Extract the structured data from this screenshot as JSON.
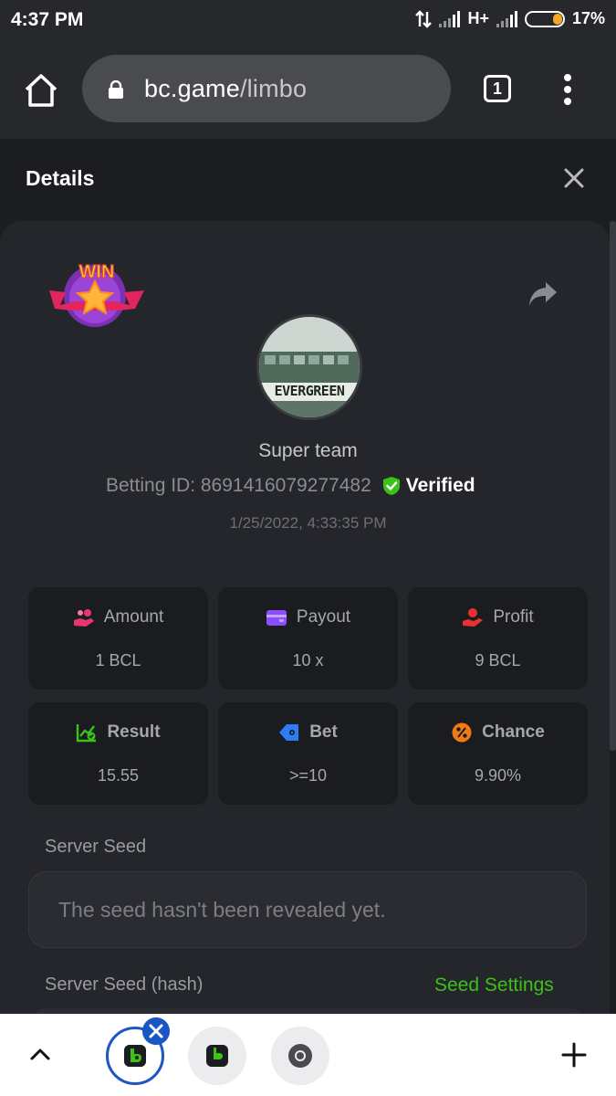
{
  "status_bar": {
    "time": "4:37 PM",
    "network": "H+",
    "battery": "17%"
  },
  "browser": {
    "url_domain": "bc.game",
    "url_path": "/limbo",
    "tab_count": "1"
  },
  "details": {
    "title": "Details",
    "username": "Super team",
    "betting_id_label": "Betting ID: 8691416079277482",
    "verified_label": "Verified",
    "timestamp": "1/25/2022, 4:33:35 PM",
    "avatar_text": "EVERGREEN",
    "win_badge_text": "WIN"
  },
  "stats": [
    {
      "label": "Amount",
      "value": "1 BCL",
      "icon": "coins-hand-icon",
      "color": "#e8376c"
    },
    {
      "label": "Payout",
      "value": "10 x",
      "icon": "wallet-icon",
      "color": "#8a4dff"
    },
    {
      "label": "Profit",
      "value": "9 BCL",
      "icon": "hand-coin-icon",
      "color": "#e8322f"
    },
    {
      "label": "Result",
      "value": "15.55",
      "icon": "chart-check-icon",
      "color": "#3bc117"
    },
    {
      "label": "Bet",
      "value": ">=10",
      "icon": "tag-icon",
      "color": "#2c7cf6"
    },
    {
      "label": "Chance",
      "value": "9.90%",
      "icon": "percent-icon",
      "color": "#f07b16"
    }
  ],
  "server_seed": {
    "label": "Server Seed",
    "value": "The seed hasn't been revealed yet."
  },
  "server_seed_hash": {
    "label": "Server Seed (hash)",
    "settings_link": "Seed Settings"
  }
}
